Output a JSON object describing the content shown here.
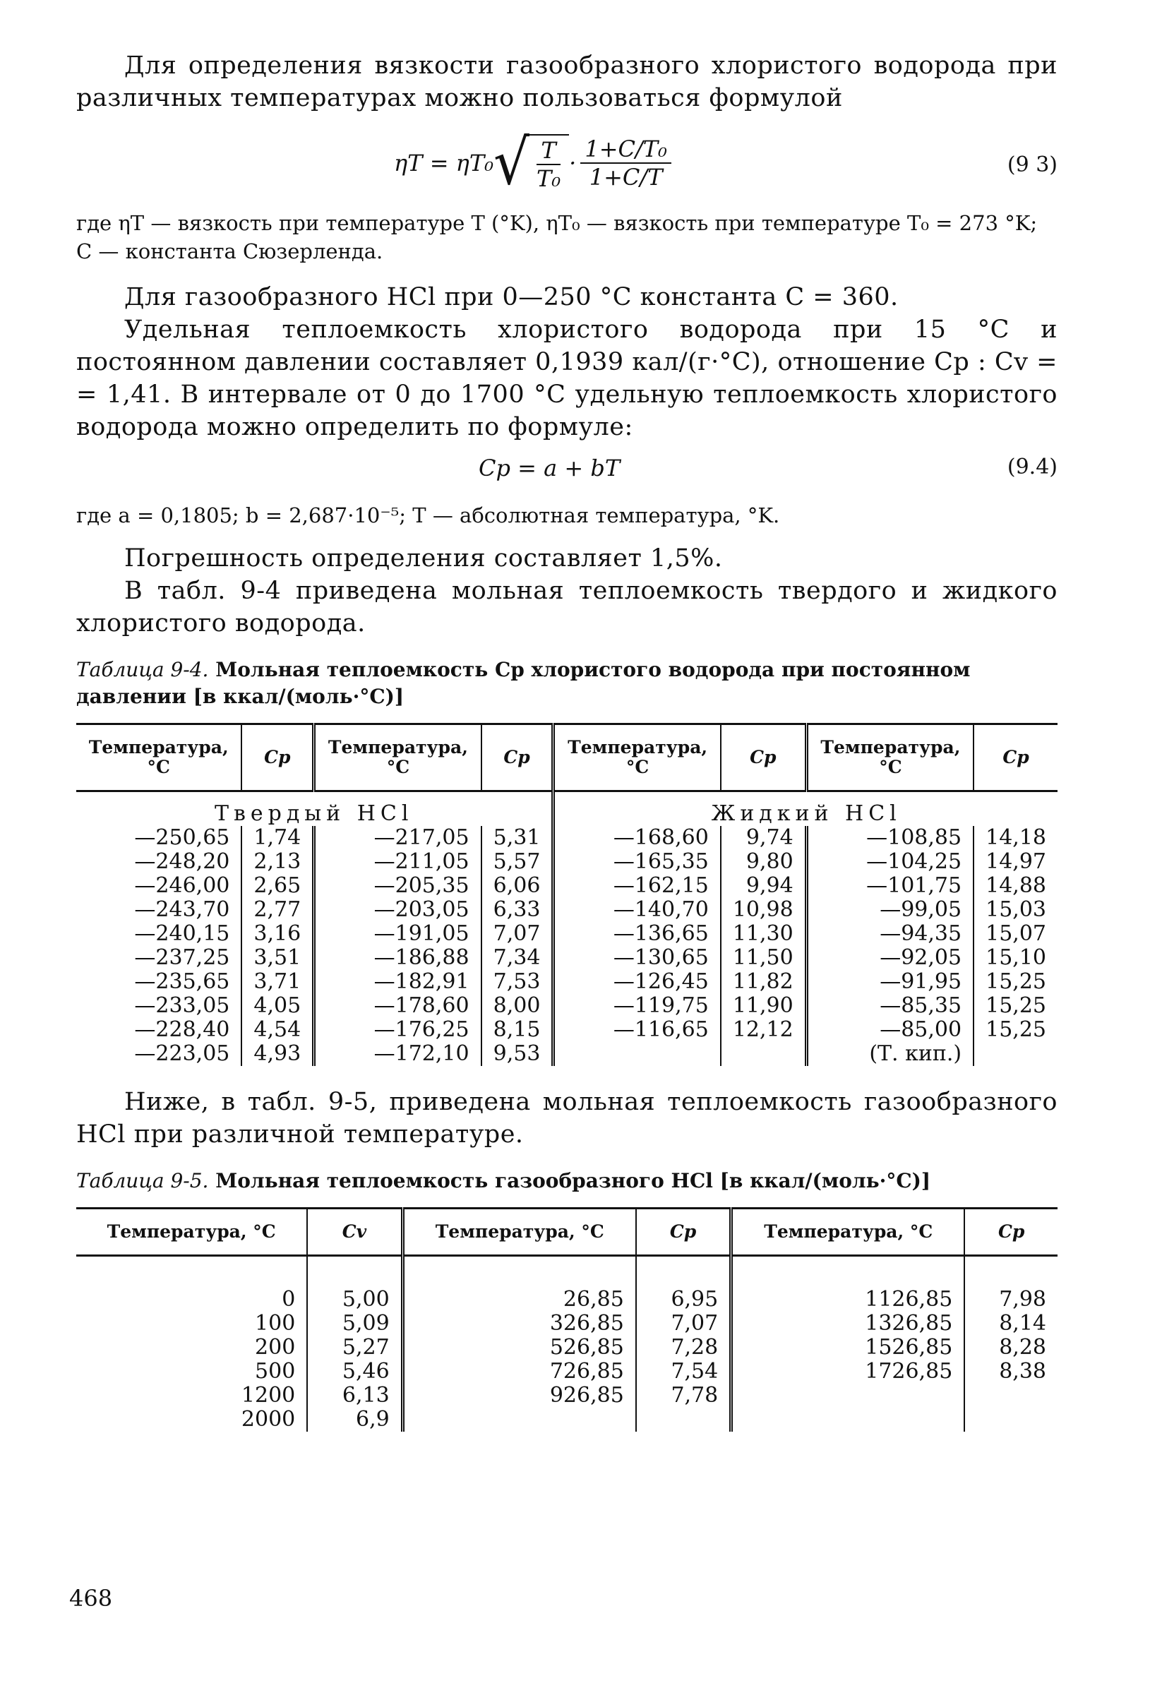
{
  "paragraphs": {
    "p1": "Для определения вязкости газообразного хлористого водорода при различных температурах можно пользоваться формулой",
    "p1_where": "где ηT — вязкость при температуре T (°K), ηT₀ — вязкость при температуре T₀ = 273 °K; C — константа Сюзерленда.",
    "p2": "Для газообразного HCl при 0—250 °C константа C = 360.",
    "p3": "Удельная теплоемкость хлористого водорода при 15 °C и постоянном давлении составляет 0,1939 кал/(г·°C), отношение Cp : Cv = = 1,41. В интервале от 0 до 1700 °C удельную теплоемкость хлористого водорода можно определить по формуле:",
    "p3_where": "где a = 0,1805; b = 2,687·10⁻⁵; T — абсолютная температура, °K.",
    "p4": "Погрешность определения составляет 1,5%.",
    "p5": "В табл. 9-4 приведена мольная теплоемкость твердого и жидкого хлористого водорода.",
    "p6": "Ниже, в табл. 9-5, приведена мольная теплоемкость газообразного HCl при различной температуре."
  },
  "formulas": {
    "f93": {
      "lhs": "ηT = ηT₀",
      "sqrt_num": "T",
      "sqrt_den": "T₀",
      "frac_num": "1+C/T₀",
      "frac_den": "1+C/T",
      "number": "(9 3)"
    },
    "f94": {
      "text": "Cp = a + bT",
      "number": "(9.4)"
    }
  },
  "table94": {
    "caption_label": "Таблица 9-4.",
    "caption_text": "Мольная теплоемкость Cp хлористого водорода при постоянном давлении [в ккал/(моль·°C)]",
    "header_temp": "Температура, °C",
    "header_cp": "Cp",
    "section_solid": "Твердый HCl",
    "section_liquid": "Жидкий HCl",
    "boiling_note": "(Т. кип.)",
    "rows": [
      [
        "—250,65",
        "1,74",
        "—217,05",
        "5,31",
        "—168,60",
        "9,74",
        "—108,85",
        "14,18"
      ],
      [
        "—248,20",
        "2,13",
        "—211,05",
        "5,57",
        "—165,35",
        "9,80",
        "—104,25",
        "14,97"
      ],
      [
        "—246,00",
        "2,65",
        "—205,35",
        "6,06",
        "—162,15",
        "9,94",
        "—101,75",
        "14,88"
      ],
      [
        "—243,70",
        "2,77",
        "—203,05",
        "6,33",
        "—140,70",
        "10,98",
        "—99,05",
        "15,03"
      ],
      [
        "—240,15",
        "3,16",
        "—191,05",
        "7,07",
        "—136,65",
        "11,30",
        "—94,35",
        "15,07"
      ],
      [
        "—237,25",
        "3,51",
        "—186,88",
        "7,34",
        "—130,65",
        "11,50",
        "—92,05",
        "15,10"
      ],
      [
        "—235,65",
        "3,71",
        "—182,91",
        "7,53",
        "—126,45",
        "11,82",
        "—91,95",
        "15,25"
      ],
      [
        "—233,05",
        "4,05",
        "—178,60",
        "8,00",
        "—119,75",
        "11,90",
        "—85,35",
        "15,25"
      ],
      [
        "—228,40",
        "4,54",
        "—176,25",
        "8,15",
        "—116,65",
        "12,12",
        "—85,00",
        "15,25"
      ],
      [
        "—223,05",
        "4,93",
        "—172,10",
        "9,53",
        "",
        "",
        "(Т. кип.)",
        ""
      ]
    ]
  },
  "table95": {
    "caption_label": "Таблица 9-5.",
    "caption_text": "Мольная теплоемкость газообразного HCl [в ккал/(моль·°C)]",
    "header_temp": "Температура, °C",
    "header_cv": "Cv",
    "header_cp": "Cp",
    "rows": [
      [
        "0",
        "5,00",
        "26,85",
        "6,95",
        "1126,85",
        "7,98"
      ],
      [
        "100",
        "5,09",
        "326,85",
        "7,07",
        "1326,85",
        "8,14"
      ],
      [
        "200",
        "5,27",
        "526,85",
        "7,28",
        "1526,85",
        "8,28"
      ],
      [
        "500",
        "5,46",
        "726,85",
        "7,54",
        "1726,85",
        "8,38"
      ],
      [
        "1200",
        "6,13",
        "926,85",
        "7,78",
        "",
        ""
      ],
      [
        "2000",
        "6,9",
        "",
        "",
        "",
        ""
      ]
    ]
  },
  "page_number": "468"
}
